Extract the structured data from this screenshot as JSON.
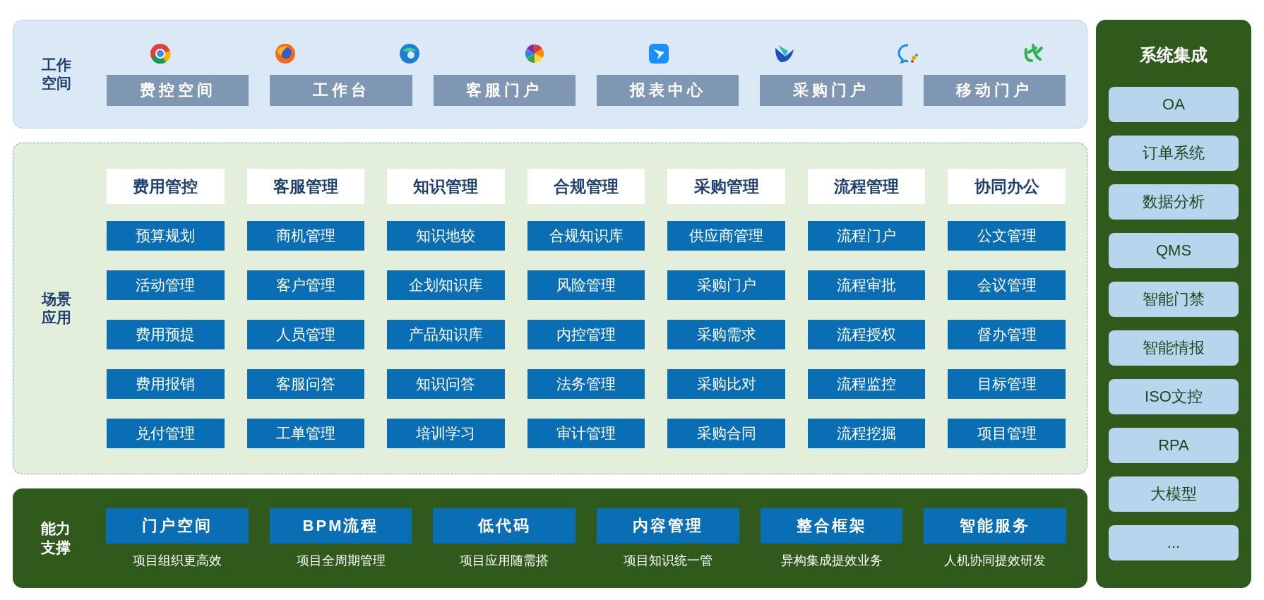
{
  "workspace": {
    "label": "工作空间",
    "items": [
      "费控空间",
      "工作台",
      "客服门户",
      "报表中心",
      "采购门户",
      "移动门户"
    ]
  },
  "scenarios": {
    "label": "场景应用",
    "columns": [
      {
        "title": "费用管控",
        "items": [
          "预算规划",
          "活动管理",
          "费用预提",
          "费用报销",
          "兑付管理"
        ]
      },
      {
        "title": "客服管理",
        "items": [
          "商机管理",
          "客户管理",
          "人员管理",
          "客服问答",
          "工单管理"
        ]
      },
      {
        "title": "知识管理",
        "items": [
          "知识地较",
          "企划知识库",
          "产品知识库",
          "知识问答",
          "培训学习"
        ]
      },
      {
        "title": "合规管理",
        "items": [
          "合规知识库",
          "风险管理",
          "内控管理",
          "法务管理",
          "审计管理"
        ]
      },
      {
        "title": "采购管理",
        "items": [
          "供应商管理",
          "采购门户",
          "采购需求",
          "采购比对",
          "采购合同"
        ]
      },
      {
        "title": "流程管理",
        "items": [
          "流程门户",
          "流程审批",
          "流程授权",
          "流程监控",
          "流程挖掘"
        ]
      },
      {
        "title": "协同办公",
        "items": [
          "公文管理",
          "会议管理",
          "督办管理",
          "目标管理",
          "项目管理"
        ]
      }
    ]
  },
  "capabilities": {
    "label": "能力支撑",
    "items": [
      {
        "name": "门户空间",
        "caption": "项目组织更高效"
      },
      {
        "name": "BPM流程",
        "caption": "项目全周期管理"
      },
      {
        "name": "低代码",
        "caption": "项目应用随需搭"
      },
      {
        "name": "内容管理",
        "caption": "项目知识统一管"
      },
      {
        "name": "整合框架",
        "caption": "异构集成提效业务"
      },
      {
        "name": "智能服务",
        "caption": "人机协同提效研发"
      }
    ]
  },
  "integration": {
    "title": "系统集成",
    "items": [
      "OA",
      "订单系统",
      "数据分析",
      "QMS",
      "智能门禁",
      "智能情报",
      "ISO文控",
      "RPA",
      "大模型",
      "..."
    ]
  }
}
